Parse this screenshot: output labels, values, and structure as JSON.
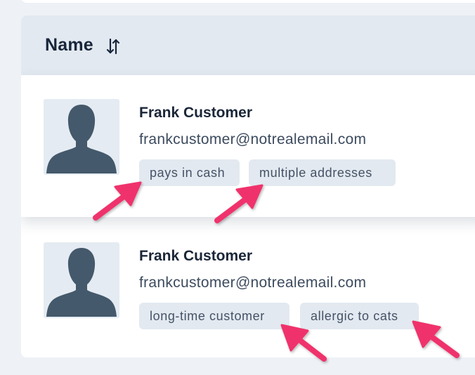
{
  "table": {
    "header_label": "Name"
  },
  "customers": [
    {
      "name": "Frank Customer",
      "email": "frankcustomer@notrealemail.com",
      "tags": [
        "pays in cash",
        "multiple addresses"
      ]
    },
    {
      "name": "Frank Customer",
      "email": "frankcustomer@notrealemail.com",
      "tags": [
        "long-time customer",
        "allergic to cats"
      ]
    }
  ],
  "colors": {
    "page_background": "#eef2f7",
    "header_background": "#e3e9f1",
    "tag_background": "#e3e9f0",
    "avatar_background": "#e5ebf2",
    "avatar_silhouette": "#44596b",
    "annotation_arrow": "#f0336c"
  },
  "icons": {
    "sort": "sort-arrows-icon",
    "avatar": "person-silhouette-icon",
    "annotation": "annotation-arrow-icon"
  }
}
